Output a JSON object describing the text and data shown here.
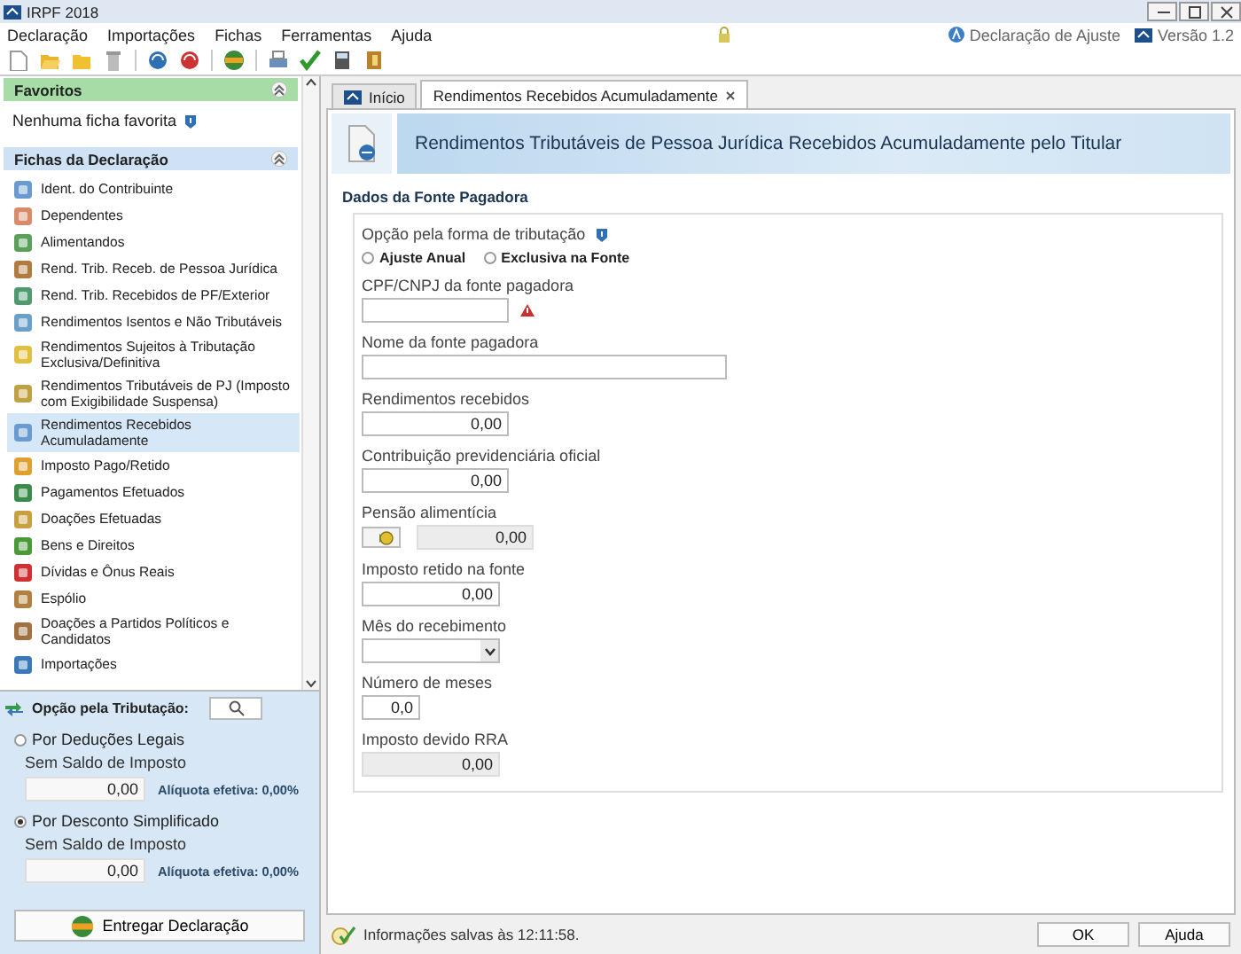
{
  "window": {
    "title": "IRPF 2018"
  },
  "menu": [
    "Declaração",
    "Importações",
    "Fichas",
    "Ferramentas",
    "Ajuda"
  ],
  "header_info": {
    "declaration": "Declaração de Ajuste",
    "version": "Versão 1.2"
  },
  "sidebar": {
    "favorites": {
      "title": "Favoritos",
      "empty_text": "Nenhuma ficha favorita",
      "expanded": true
    },
    "forms": {
      "title": "Fichas da Declaração",
      "expanded": true,
      "items": [
        {
          "label": "Ident. do Contribuinte",
          "selected": false
        },
        {
          "label": "Dependentes",
          "selected": false
        },
        {
          "label": "Alimentandos",
          "selected": false
        },
        {
          "label": "Rend. Trib. Receb. de Pessoa Jurídica",
          "selected": false
        },
        {
          "label": "Rend. Trib. Recebidos de PF/Exterior",
          "selected": false
        },
        {
          "label": "Rendimentos Isentos e Não Tributáveis",
          "selected": false
        },
        {
          "label": "Rendimentos Sujeitos à Tributação Exclusiva/Definitiva",
          "selected": false
        },
        {
          "label": "Rendimentos Tributáveis de PJ (Imposto com Exigibilidade Suspensa)",
          "selected": false
        },
        {
          "label": "Rendimentos Recebidos Acumuladamente",
          "selected": true
        },
        {
          "label": "Imposto Pago/Retido",
          "selected": false
        },
        {
          "label": "Pagamentos Efetuados",
          "selected": false
        },
        {
          "label": "Doações Efetuadas",
          "selected": false
        },
        {
          "label": "Bens e Direitos",
          "selected": false
        },
        {
          "label": "Dívidas e Ônus Reais",
          "selected": false
        },
        {
          "label": "Espólio",
          "selected": false
        },
        {
          "label": "Doações a Partidos Políticos e Candidatos",
          "selected": false
        },
        {
          "label": "Importações",
          "selected": false
        }
      ]
    }
  },
  "taxation": {
    "title": "Opção pela Tributação:",
    "options": [
      {
        "label": "Por Deduções Legais",
        "selected": false,
        "sublabel": "Sem Saldo de Imposto",
        "value": "0,00",
        "rate": "Alíquota efetiva: 0,00%"
      },
      {
        "label": "Por Desconto Simplificado",
        "selected": true,
        "sublabel": "Sem Saldo de Imposto",
        "value": "0,00",
        "rate": "Alíquota efetiva: 0,00%"
      }
    ],
    "submit": "Entregar Declaração"
  },
  "tabs": [
    {
      "label": "Início",
      "selected": false,
      "closable": false
    },
    {
      "label": "Rendimentos Recebidos Acumuladamente",
      "selected": true,
      "closable": true
    }
  ],
  "page_title": "Rendimentos Tributáveis de Pessoa Jurídica Recebidos Acumuladamente pelo Titular",
  "section_title": "Dados da Fonte Pagadora",
  "tax_choice": {
    "label": "Opção pela forma de tributação",
    "options": [
      {
        "label": "Ajuste Anual",
        "selected": false
      },
      {
        "label": "Exclusiva na Fonte",
        "selected": false
      }
    ]
  },
  "fields": [
    {
      "kind": "text",
      "label": "CPF/CNPJ da fonte pagadora",
      "warning": true
    },
    {
      "kind": "name",
      "label": "Nome da fonte pagadora"
    },
    {
      "kind": "money",
      "label": "Rendimentos recebidos",
      "value": "0,00"
    },
    {
      "kind": "money",
      "label": "Contribuição previdenciária oficial",
      "value": "0,00"
    },
    {
      "kind": "pension",
      "label": "Pensão alimentícia",
      "value": "0,00"
    },
    {
      "kind": "money-short",
      "label": "Imposto retido na fonte",
      "value": "0,00"
    },
    {
      "kind": "select",
      "label": "Mês do recebimento"
    },
    {
      "kind": "count",
      "label": "Número de meses",
      "value": "0,0"
    },
    {
      "kind": "readonly",
      "label": "Imposto devido RRA",
      "value": "0,00"
    }
  ],
  "status_bar": "Informações salvas às 12:11:58.",
  "buttons": [
    "OK",
    "Ajuda"
  ]
}
